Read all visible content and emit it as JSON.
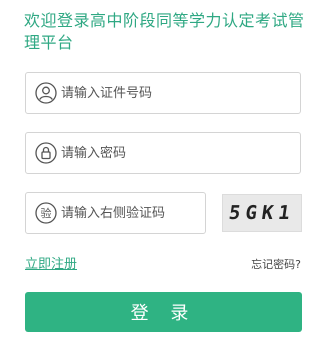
{
  "header": {
    "title": "欢迎登录高中阶段同等学力认定考试管理平台"
  },
  "form": {
    "id_number": {
      "placeholder": "请输入证件号码",
      "icon": "user-icon"
    },
    "password": {
      "placeholder": "请输入密码",
      "icon": "lock-icon"
    },
    "captcha_input": {
      "placeholder": "请输入右侧验证码",
      "icon": "verify-icon"
    },
    "captcha_image_text": "5GK1"
  },
  "links": {
    "register": "立即注册",
    "forgot_password": "忘记密码?"
  },
  "actions": {
    "login_label": "登 录"
  },
  "colors": {
    "accent": "#2fa883",
    "button": "#2fb383"
  }
}
